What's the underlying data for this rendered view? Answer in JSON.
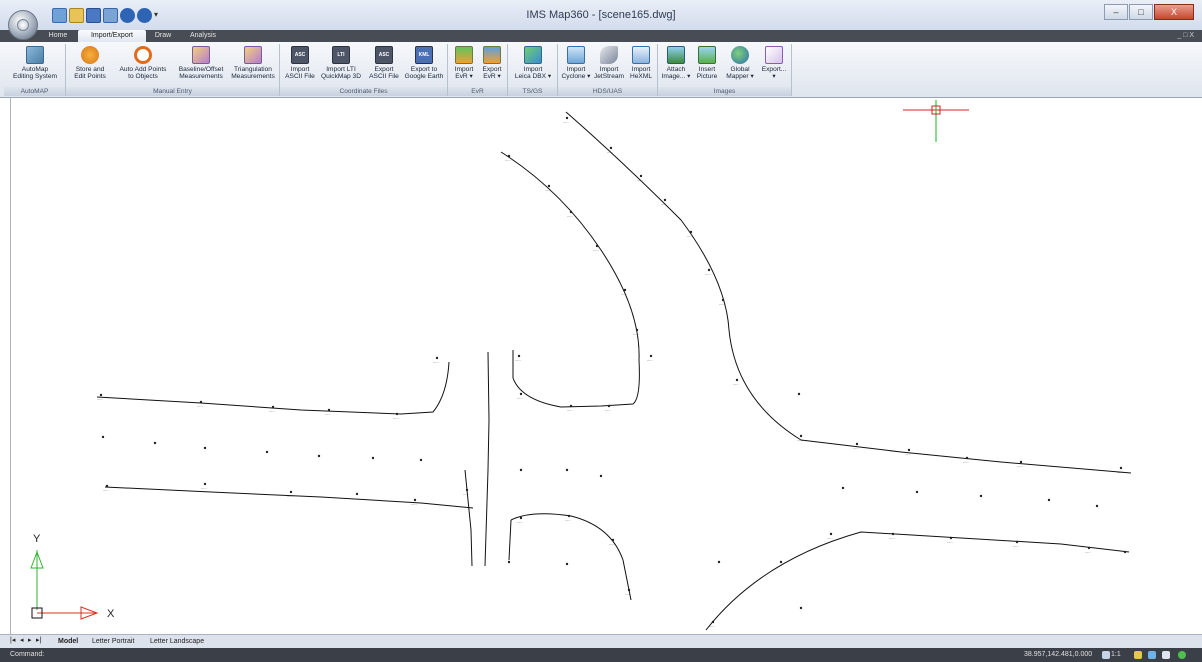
{
  "window": {
    "title": "IMS Map360 - [scene165.dwg]",
    "minimize": "–",
    "maximize": "□",
    "close": "X"
  },
  "ribbon_tabs": [
    {
      "label": "Home"
    },
    {
      "label": "Import/Export",
      "active": true
    },
    {
      "label": "Draw"
    },
    {
      "label": "Analysis"
    }
  ],
  "ribbon_right": "_ □ X",
  "ribbon_groups": [
    {
      "label": "AutoMAP",
      "buttons": [
        {
          "label": "AutoMap\nEditing System",
          "icon": "automap-icon"
        }
      ]
    },
    {
      "label": "Manual Entry",
      "buttons": [
        {
          "label": "Store and\nEdit Points",
          "icon": "store-points-icon"
        },
        {
          "label": "Auto Add Points\nto Objects",
          "icon": "auto-add-points-icon"
        },
        {
          "label": "Baseline/Offset\nMeasurements",
          "icon": "baseline-offset-icon"
        },
        {
          "label": "Triangulation\nMeasurements",
          "icon": "triangulation-icon"
        }
      ]
    },
    {
      "label": "Coordinate Files",
      "buttons": [
        {
          "label": "Import\nASCII File",
          "icon": "import-ascii-icon",
          "badge": "ASC"
        },
        {
          "label": "Import LTI\nQuickMap 3D",
          "icon": "import-lti-icon",
          "badge": "LTI"
        },
        {
          "label": "Export\nASCII File",
          "icon": "export-ascii-icon",
          "badge": "ASC"
        },
        {
          "label": "Export to\nGoogle Earth",
          "icon": "export-kml-icon",
          "badge": "KML"
        }
      ]
    },
    {
      "label": "EvR",
      "buttons": [
        {
          "label": "Import\nEvR ▾",
          "icon": "import-evr-icon"
        },
        {
          "label": "Export\nEvR ▾",
          "icon": "export-evr-icon"
        }
      ]
    },
    {
      "label": "TS/GS",
      "buttons": [
        {
          "label": "Import\nLeica DBX ▾",
          "icon": "import-leica-icon"
        }
      ]
    },
    {
      "label": "HDS/UAS",
      "buttons": [
        {
          "label": "Import\nCyclone ▾",
          "icon": "import-cyclone-icon"
        },
        {
          "label": "Import\nJetStream",
          "icon": "import-jetstream-icon"
        },
        {
          "label": "Import\nHeXML",
          "icon": "import-hexml-icon"
        }
      ]
    },
    {
      "label": "Images",
      "buttons": [
        {
          "label": "Attach\nImage... ▾",
          "icon": "attach-image-icon"
        },
        {
          "label": "Insert\nPicture",
          "icon": "insert-picture-icon"
        },
        {
          "label": "Global\nMapper ▾",
          "icon": "global-mapper-icon"
        },
        {
          "label": "Export...\n▾",
          "icon": "export-image-icon"
        }
      ]
    }
  ],
  "axes": {
    "x_label": "X",
    "y_label": "Y"
  },
  "sheet_tabs": [
    {
      "label": "Model",
      "active": true
    },
    {
      "label": "Letter Portrait"
    },
    {
      "label": "Letter Landscape"
    }
  ],
  "status": {
    "command_label": "Command:",
    "coordinates": "38.957,142.481,0.000",
    "scale": "1:1"
  },
  "colors": {
    "ucs_x": "#e0301e",
    "ucs_y": "#2fb52f",
    "cursor": "#d42020",
    "cursor_v": "#19b219",
    "line": "#111111"
  }
}
